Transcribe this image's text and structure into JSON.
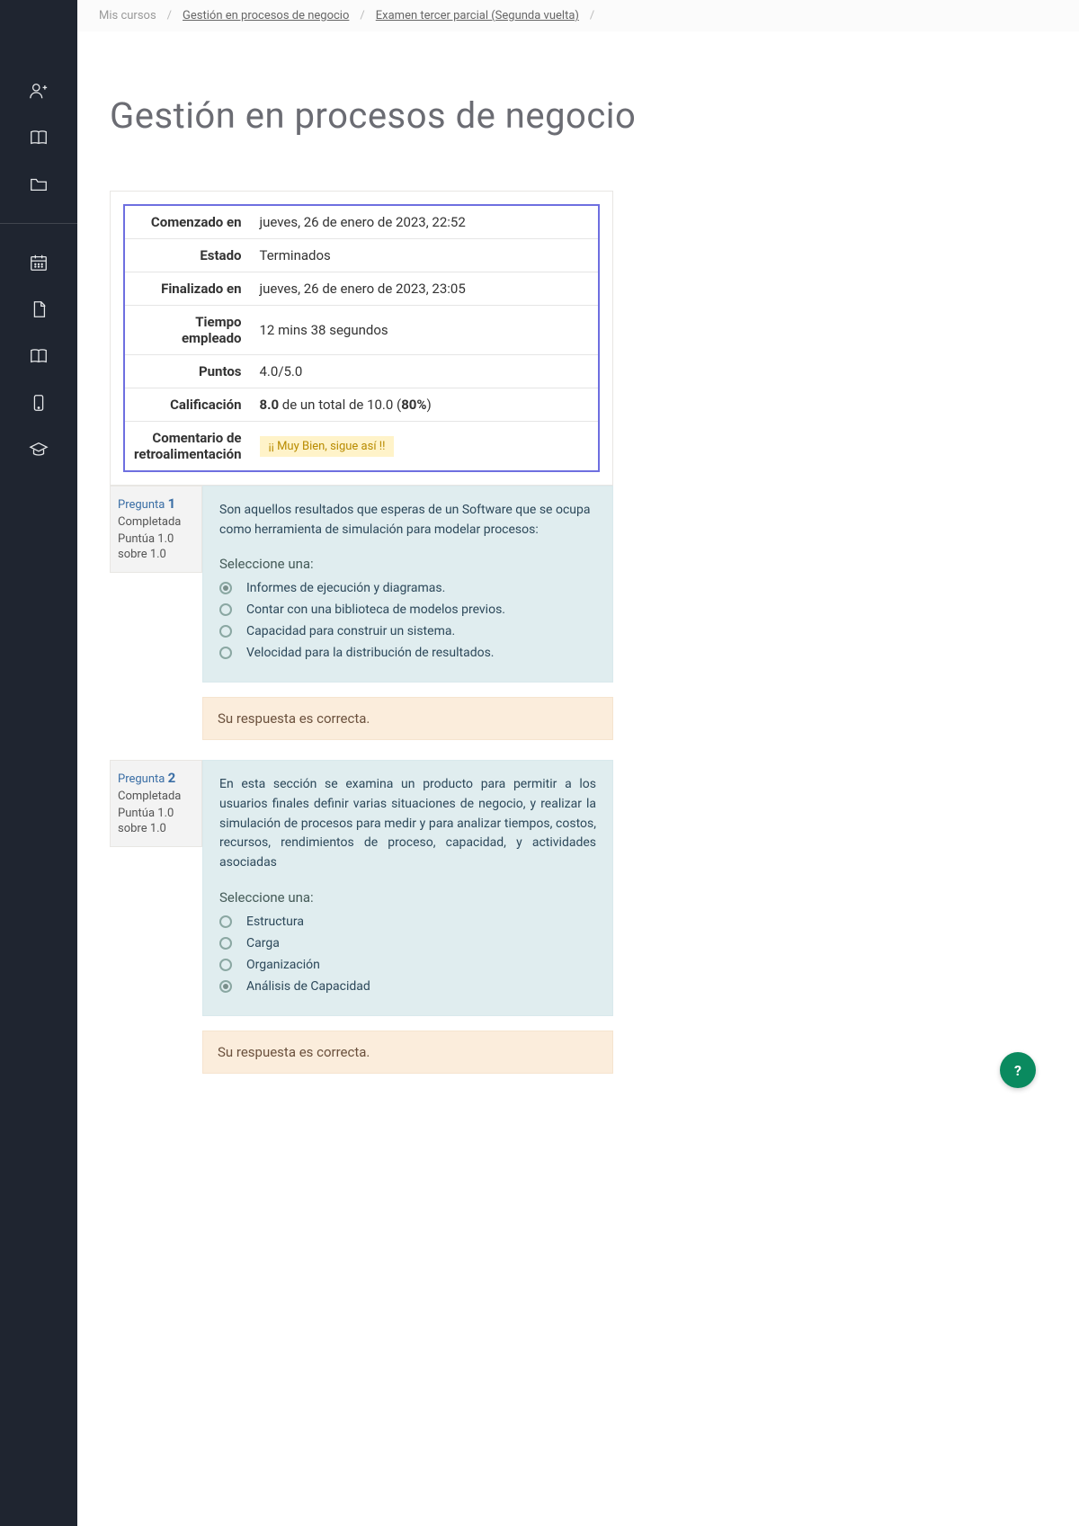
{
  "breadcrumb": {
    "my_courses": "Mis cursos",
    "course": "Gestión en procesos de negocio",
    "exam": "Examen tercer parcial (Segunda vuelta)"
  },
  "title": "Gestión en procesos de negocio",
  "summary": {
    "rows": [
      {
        "label": "Comenzado en",
        "value": "jueves, 26 de enero de 2023, 22:52"
      },
      {
        "label": "Estado",
        "value": "Terminados"
      },
      {
        "label": "Finalizado en",
        "value": "jueves, 26 de enero de 2023, 23:05"
      },
      {
        "label": "Tiempo empleado",
        "value": "12 mins 38 segundos"
      },
      {
        "label": "Puntos",
        "value": "4.0/5.0"
      }
    ],
    "grade_label": "Calificación",
    "grade_prefix": "8.0",
    "grade_mid": " de un total de 10.0 (",
    "grade_pct": "80%",
    "grade_suffix": ")",
    "feedback_label": "Comentario de retroalimentación",
    "feedback_value": "¡¡ Muy Bien, sigue así !!"
  },
  "questions": [
    {
      "label": "Pregunta",
      "number": "1",
      "state": "Completada",
      "score": "Puntúa 1.0 sobre 1.0",
      "text": "Son aquellos resultados que esperas de un Software que se ocupa como herramienta de simulación para modelar procesos:",
      "justify": false,
      "prompt": "Seleccione una:",
      "options": [
        {
          "label": "Informes de ejecución y diagramas.",
          "checked": true
        },
        {
          "label": "Contar con una biblioteca de modelos previos.",
          "checked": false
        },
        {
          "label": "Capacidad para construir un sistema.",
          "checked": false
        },
        {
          "label": "Velocidad para la distribución de resultados.",
          "checked": false
        }
      ],
      "feedback": "Su respuesta es correcta."
    },
    {
      "label": "Pregunta",
      "number": "2",
      "state": "Completada",
      "score": "Puntúa 1.0 sobre 1.0",
      "text": "En esta sección se examina un producto para permitir a los usuarios finales definir varias situaciones de negocio, y realizar la simulación de procesos para medir y para analizar tiempos, costos, recursos, rendimientos de proceso, capacidad, y actividades asociadas",
      "justify": true,
      "prompt": "Seleccione una:",
      "options": [
        {
          "label": "Estructura",
          "checked": false
        },
        {
          "label": "Carga",
          "checked": false
        },
        {
          "label": "Organización",
          "checked": false
        },
        {
          "label": "Análisis de Capacidad",
          "checked": true
        }
      ],
      "feedback": "Su respuesta es correcta."
    }
  ],
  "help": {
    "label": "?"
  }
}
